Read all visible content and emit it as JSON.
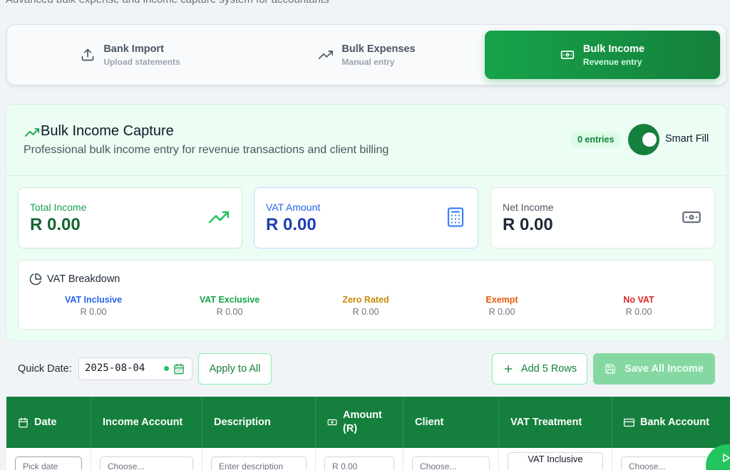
{
  "header": {
    "subtitle": "Advanced bulk expense and income capture system for accountants"
  },
  "tabs": [
    {
      "title": "Bank Import",
      "sub": "Upload statements",
      "icon": "upload-icon"
    },
    {
      "title": "Bulk Expenses",
      "sub": "Manual entry",
      "icon": "trending-up-icon"
    },
    {
      "title": "Bulk Income",
      "sub": "Revenue entry",
      "icon": "banknote-icon",
      "active": true
    }
  ],
  "panel": {
    "title": "Bulk Income Capture",
    "subtitle": "Professional bulk income entry for revenue transactions and client billing",
    "entries": "0 entries",
    "smart_fill": "Smart Fill"
  },
  "cards": [
    {
      "label": "Total Income",
      "value": "R 0.00",
      "icon": "trending-up-icon"
    },
    {
      "label": "VAT Amount",
      "value": "R 0.00",
      "icon": "calculator-icon"
    },
    {
      "label": "Net Income",
      "value": "R 0.00",
      "icon": "banknote-icon"
    }
  ],
  "vat_breakdown": {
    "title": "VAT Breakdown",
    "items": [
      {
        "name": "VAT Inclusive",
        "value": "R 0.00",
        "color": "#2563eb"
      },
      {
        "name": "VAT Exclusive",
        "value": "R 0.00",
        "color": "#16a34a"
      },
      {
        "name": "Zero Rated",
        "value": "R 0.00",
        "color": "#ca8a04"
      },
      {
        "name": "Exempt",
        "value": "R 0.00",
        "color": "#ea580c"
      },
      {
        "name": "No VAT",
        "value": "R 0.00",
        "color": "#dc2626"
      }
    ]
  },
  "toolbar": {
    "quick_date_label": "Quick Date:",
    "date_value": "2025-08-04",
    "apply_label": "Apply to All",
    "add_rows_label": "Add 5 Rows",
    "save_label": "Save All Income"
  },
  "table": {
    "headers": [
      "Date",
      "Income Account",
      "Description",
      "Amount (R)",
      "Client",
      "VAT Treatment",
      "Bank Account"
    ],
    "row": [
      "Pick date",
      "Choose...",
      "Enter description",
      "R 0.00",
      "Choose...",
      "VAT Inclusive",
      "Choose..."
    ]
  },
  "colors": {
    "accent": "#15803d",
    "accent_light": "#16a34a",
    "panel_bg": "#ecfdf3"
  }
}
